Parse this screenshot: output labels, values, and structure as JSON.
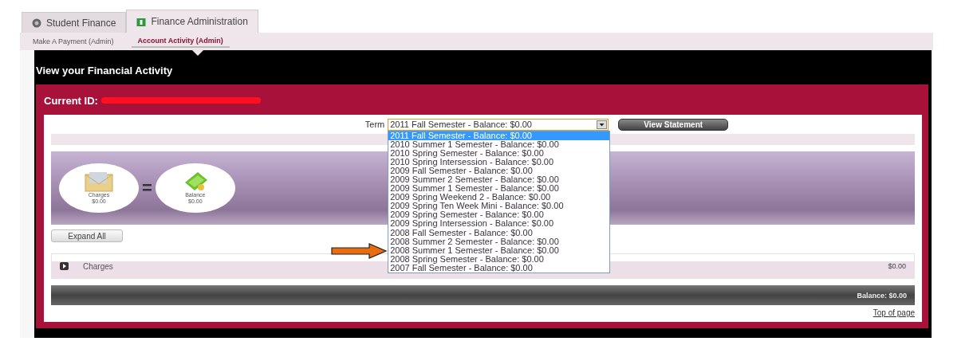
{
  "tabs": [
    {
      "label": "Student Finance",
      "selected": false
    },
    {
      "label": "Finance Administration",
      "selected": true
    }
  ],
  "subtabs": [
    {
      "label": "Make A Payment (Admin)",
      "selected": false
    },
    {
      "label": "Account Activity (Admin)",
      "selected": true
    }
  ],
  "page_title": "View your Financial Activity",
  "current_id_label": "Current ID:",
  "term": {
    "label": "Term",
    "value": "2011 Fall Semester - Balance: $0.00",
    "expanded": true,
    "options": [
      {
        "label": "2011 Fall Semester - Balance: $0.00",
        "selected": true
      },
      {
        "label": "2010 Summer 1 Semester - Balance: $0.00",
        "selected": false
      },
      {
        "label": "2010 Spring Semester - Balance: $0.00",
        "selected": false
      },
      {
        "label": "2010 Spring Intersession - Balance: $0.00",
        "selected": false
      },
      {
        "label": "2009 Fall Semester - Balance: $0.00",
        "selected": false
      },
      {
        "label": "2009 Summer 2 Semester - Balance: $0.00",
        "selected": false
      },
      {
        "label": "2009 Summer 1 Semester - Balance: $0.00",
        "selected": false
      },
      {
        "label": "2009 Spring Weekend 2 - Balance: $0.00",
        "selected": false
      },
      {
        "label": "2009 Spring Ten Week Mini - Balance: $0.00",
        "selected": false
      },
      {
        "label": "2009 Spring Semester - Balance: $0.00",
        "selected": false
      },
      {
        "label": "2009 Spring Intersession - Balance: $0.00",
        "selected": false
      },
      {
        "label": "2008 Fall Semester - Balance: $0.00",
        "selected": false
      },
      {
        "label": "2008 Summer 2 Semester - Balance: $0.00",
        "selected": false
      },
      {
        "label": "2008 Summer 1 Semester - Balance: $0.00",
        "selected": false
      },
      {
        "label": "2008 Spring Semester - Balance: $0.00",
        "selected": false
      },
      {
        "label": "2007 Fall Semester - Balance: $0.00",
        "selected": false
      }
    ]
  },
  "view_statement_button": "View Statement",
  "summary": [
    {
      "label": "Charges",
      "amount": "$0.00"
    },
    {
      "label": "Balance",
      "amount": "$0.00"
    }
  ],
  "summary_operator": "=",
  "expand_all_button": "Expand All",
  "sections": [
    {
      "label": "Charges",
      "amount": "$0.00",
      "expanded": false
    }
  ],
  "balance_total": "Balance: $0.00",
  "top_link": "Top of page"
}
